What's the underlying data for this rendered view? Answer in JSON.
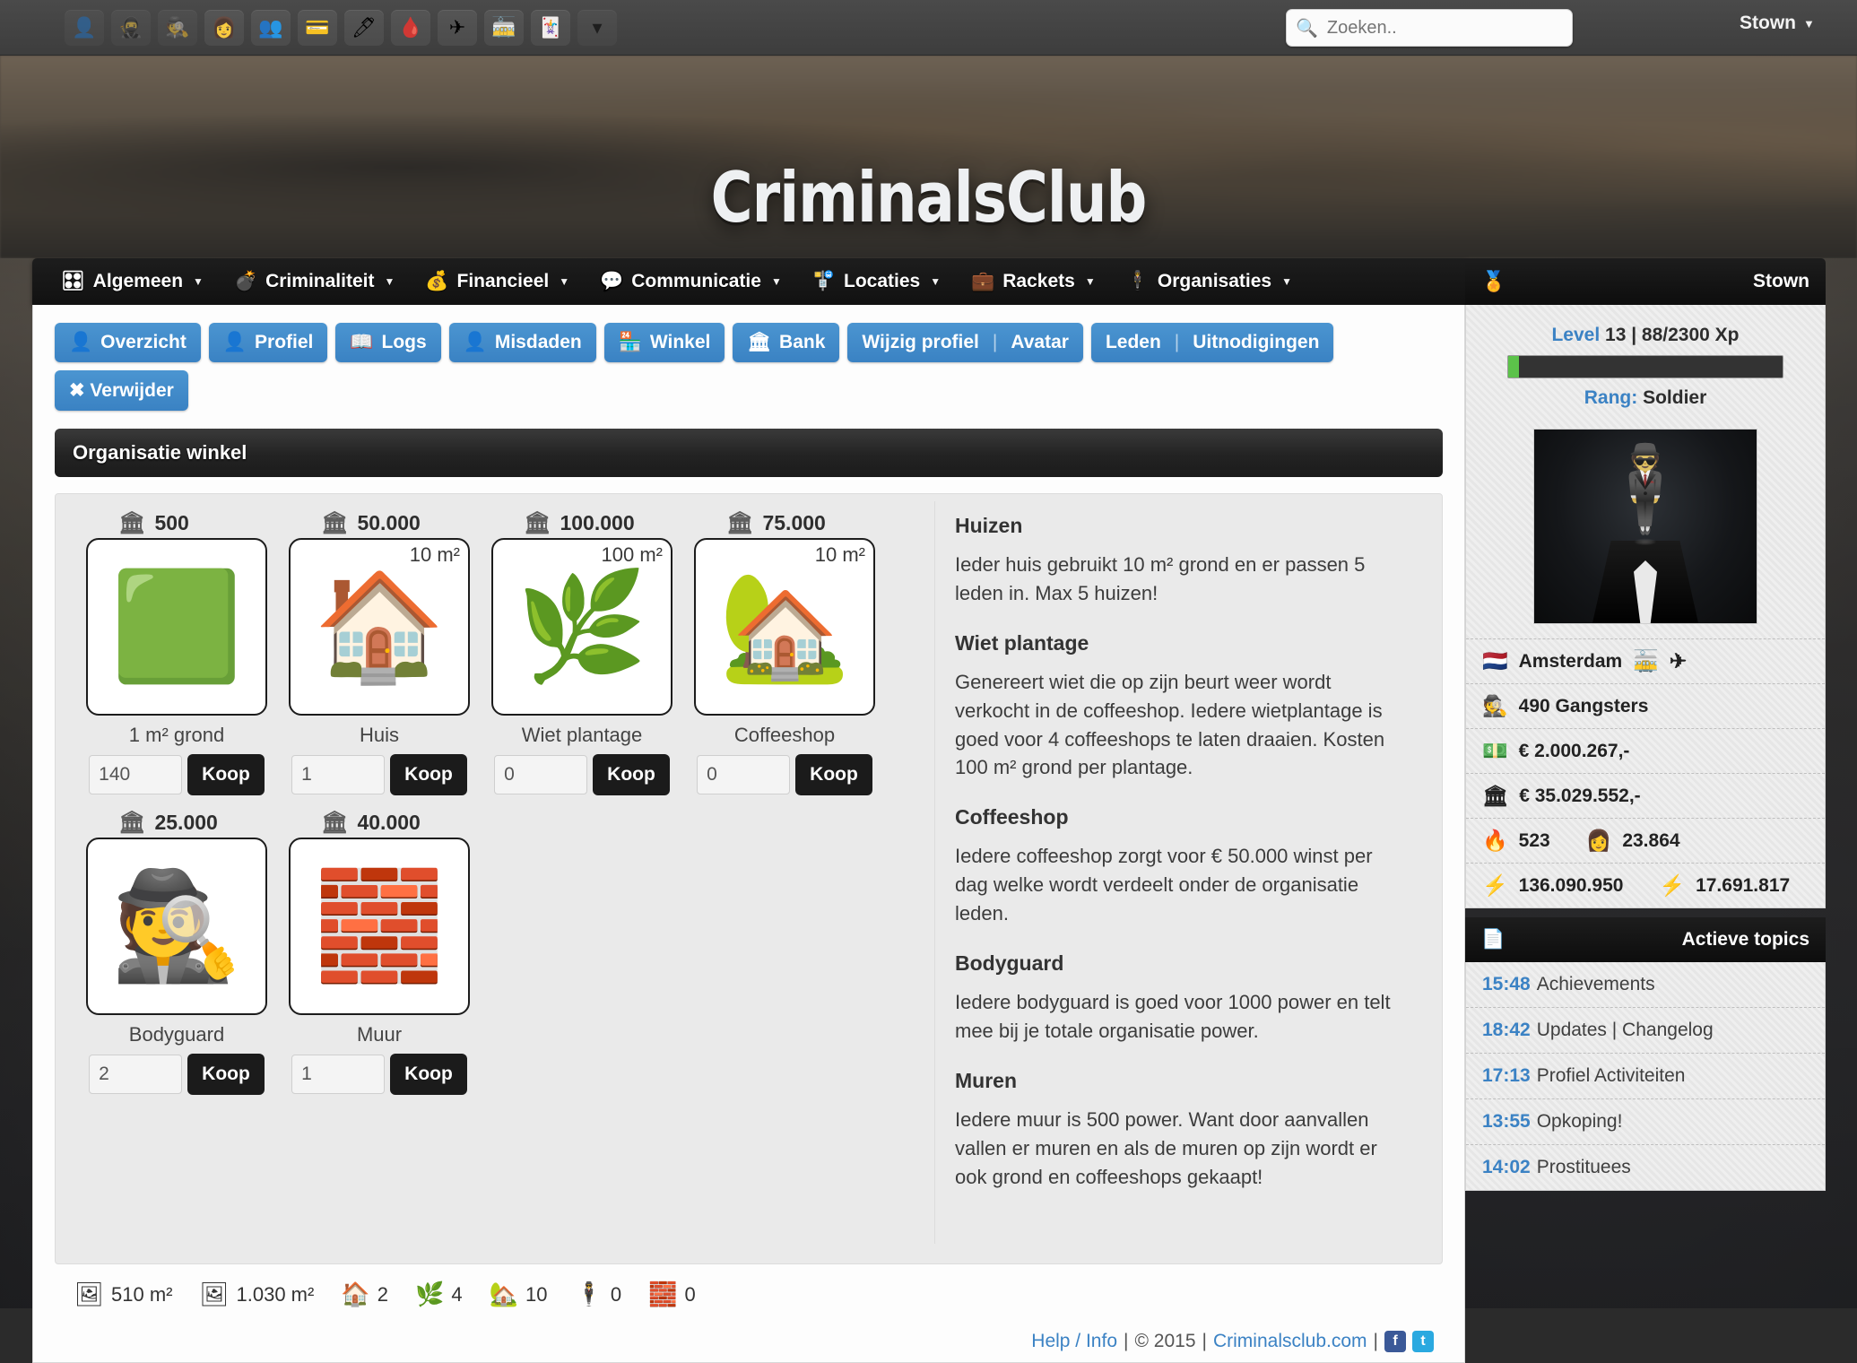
{
  "topbar": {
    "icons": [
      {
        "name": "user-dark-icon",
        "glyph": "👤",
        "dim": true
      },
      {
        "name": "ninja-icon",
        "glyph": "🥷",
        "dim": true
      },
      {
        "name": "detective-icon",
        "glyph": "🕵",
        "dim": true
      },
      {
        "name": "woman-icon",
        "glyph": "👩",
        "dim": false
      },
      {
        "name": "people-icon",
        "glyph": "👥",
        "dim": false
      },
      {
        "name": "credit-card-icon",
        "glyph": "💳",
        "dim": false
      },
      {
        "name": "pencil-icon",
        "glyph": "🖊",
        "dim": false
      },
      {
        "name": "blood-bag-icon",
        "glyph": "🩸",
        "dim": false
      },
      {
        "name": "airplane-icon",
        "glyph": "✈",
        "dim": false
      },
      {
        "name": "tram-icon",
        "glyph": "🚋",
        "dim": false
      },
      {
        "name": "playing-card-icon",
        "glyph": "🃏",
        "dim": false
      },
      {
        "name": "dropdown-icon",
        "glyph": "▾",
        "dim": true
      }
    ],
    "search_placeholder": "Zoeken..",
    "username": "Stown"
  },
  "banner": {
    "logo": "CriminalsClub"
  },
  "mainnav": [
    {
      "label": "Algemeen",
      "icon": "🎛",
      "name": "nav-algemeen"
    },
    {
      "label": "Criminaliteit",
      "icon": "💣",
      "name": "nav-criminaliteit"
    },
    {
      "label": "Financieel",
      "icon": "💰",
      "name": "nav-financieel"
    },
    {
      "label": "Communicatie",
      "icon": "💬",
      "name": "nav-communicatie"
    },
    {
      "label": "Locaties",
      "icon": "🚏",
      "name": "nav-locaties"
    },
    {
      "label": "Rackets",
      "icon": "💼",
      "name": "nav-rackets"
    },
    {
      "label": "Organisaties",
      "icon": "🕴",
      "name": "nav-organisaties"
    }
  ],
  "tabs": [
    {
      "icon": "👤",
      "label": "Overzicht",
      "name": "tab-overzicht"
    },
    {
      "icon": "👤",
      "label": "Profiel",
      "name": "tab-profiel"
    },
    {
      "icon": "📖",
      "label": "Logs",
      "name": "tab-logs"
    },
    {
      "icon": "👤",
      "label": "Misdaden",
      "name": "tab-misdaden"
    },
    {
      "icon": "🏪",
      "label": "Winkel",
      "name": "tab-winkel"
    },
    {
      "icon": "🏛",
      "label": "Bank",
      "name": "tab-bank"
    }
  ],
  "tab_groups": [
    {
      "name": "tab-group-profile",
      "parts": [
        "Wijzig profiel",
        "Avatar"
      ]
    },
    {
      "name": "tab-group-members",
      "parts": [
        "Leden",
        "Uitnodigingen"
      ]
    }
  ],
  "tab_delete": "✖ Verwijder",
  "section_title": "Organisatie winkel",
  "shop": {
    "row1": [
      {
        "name": "grond",
        "price": "500",
        "label": "1 m² grond",
        "sqm": "",
        "qty": "140",
        "buy": "Koop",
        "glyph": "🟩"
      },
      {
        "name": "huis",
        "price": "50.000",
        "label": "Huis",
        "sqm": "10 m²",
        "qty": "1",
        "buy": "Koop",
        "glyph": "🏠"
      },
      {
        "name": "wiet-plantage",
        "price": "100.000",
        "label": "Wiet plantage",
        "sqm": "100 m²",
        "qty": "0",
        "buy": "Koop",
        "glyph": "🌿"
      },
      {
        "name": "coffeeshop",
        "price": "75.000",
        "label": "Coffeeshop",
        "sqm": "10 m²",
        "qty": "0",
        "buy": "Koop",
        "glyph": "🏡"
      }
    ],
    "row2": [
      {
        "name": "bodyguard",
        "price": "25.000",
        "label": "Bodyguard",
        "sqm": "",
        "qty": "2",
        "buy": "Koop",
        "glyph": "🕵"
      },
      {
        "name": "muur",
        "price": "40.000",
        "label": "Muur",
        "sqm": "",
        "qty": "1",
        "buy": "Koop",
        "glyph": "🧱"
      }
    ]
  },
  "descriptions": [
    {
      "title": "Huizen",
      "body": "Ieder huis gebruikt 10 m² grond en er passen 5 leden in. Max 5 huizen!"
    },
    {
      "title": "Wiet plantage",
      "body": "Genereert wiet die op zijn beurt weer wordt verkocht in de coffeeshop. Iedere wietplantage is goed voor 4 coffeeshops te laten draaien. Kosten 100 m² grond per plantage."
    },
    {
      "title": "Coffeeshop",
      "body": "Iedere coffeeshop zorgt voor € 50.000 winst per dag welke wordt verdeelt onder de organisatie leden."
    },
    {
      "title": "Bodyguard",
      "body": "Iedere bodyguard is goed voor 1000 power en telt mee bij je totale organisatie power."
    },
    {
      "title": "Muren",
      "body": "Iedere muur is 500 power. Want door aanvallen vallen er muren en als de muren op zijn wordt er ook grond en coffeeshops gekaapt!"
    }
  ],
  "totals": [
    {
      "name": "free-land",
      "icon": "🖼",
      "value": "510 m²"
    },
    {
      "name": "total-land",
      "icon": "🖼",
      "value": "1.030 m²"
    },
    {
      "name": "houses",
      "icon": "🏠",
      "value": "2"
    },
    {
      "name": "plantages",
      "icon": "🌿",
      "value": "4"
    },
    {
      "name": "coffeeshops",
      "icon": "🏡",
      "value": "10"
    },
    {
      "name": "bodyguards",
      "icon": "🕴",
      "value": "0"
    },
    {
      "name": "walls",
      "icon": "🧱",
      "value": "0"
    }
  ],
  "footer": {
    "help": "Help / Info",
    "copyright": "© 2015",
    "site": "Criminalsclub.com",
    "facebook": "f",
    "twitter": "t",
    "sep": "|"
  },
  "sidebar": {
    "header_user": "Stown",
    "level_label": "Level",
    "level_value": "13 | 88/2300 Xp",
    "xp_percent": 4,
    "rank_label": "Rang:",
    "rank_value": "Soldier",
    "stats": [
      {
        "name": "location",
        "icon": "🇳🇱",
        "value": "Amsterdam",
        "extra_icons": [
          "🚋",
          "✈"
        ]
      },
      {
        "name": "gangsters",
        "icon": "🕵",
        "value": "490 Gangsters"
      },
      {
        "name": "cash",
        "icon": "💵",
        "value": "€ 2.000.267,-"
      },
      {
        "name": "bank",
        "icon": "🏛",
        "value": "€ 35.029.552,-"
      },
      {
        "name": "heat-hookers",
        "icon": "🔥",
        "value": "523",
        "icon2": "👩",
        "value2": "23.864"
      },
      {
        "name": "power",
        "icon": "⚡",
        "value": "136.090.950",
        "icon2": "⚡",
        "value2": "17.691.817"
      }
    ],
    "topics_icon": "📄",
    "topics_title": "Actieve topics",
    "topics": [
      {
        "time": "15:48",
        "title": "Achievements"
      },
      {
        "time": "18:42",
        "title": "Updates | Changelog"
      },
      {
        "time": "17:13",
        "title": "Profiel Activiteiten"
      },
      {
        "time": "13:55",
        "title": "Opkoping!"
      },
      {
        "time": "14:02",
        "title": "Prostituees"
      }
    ]
  }
}
